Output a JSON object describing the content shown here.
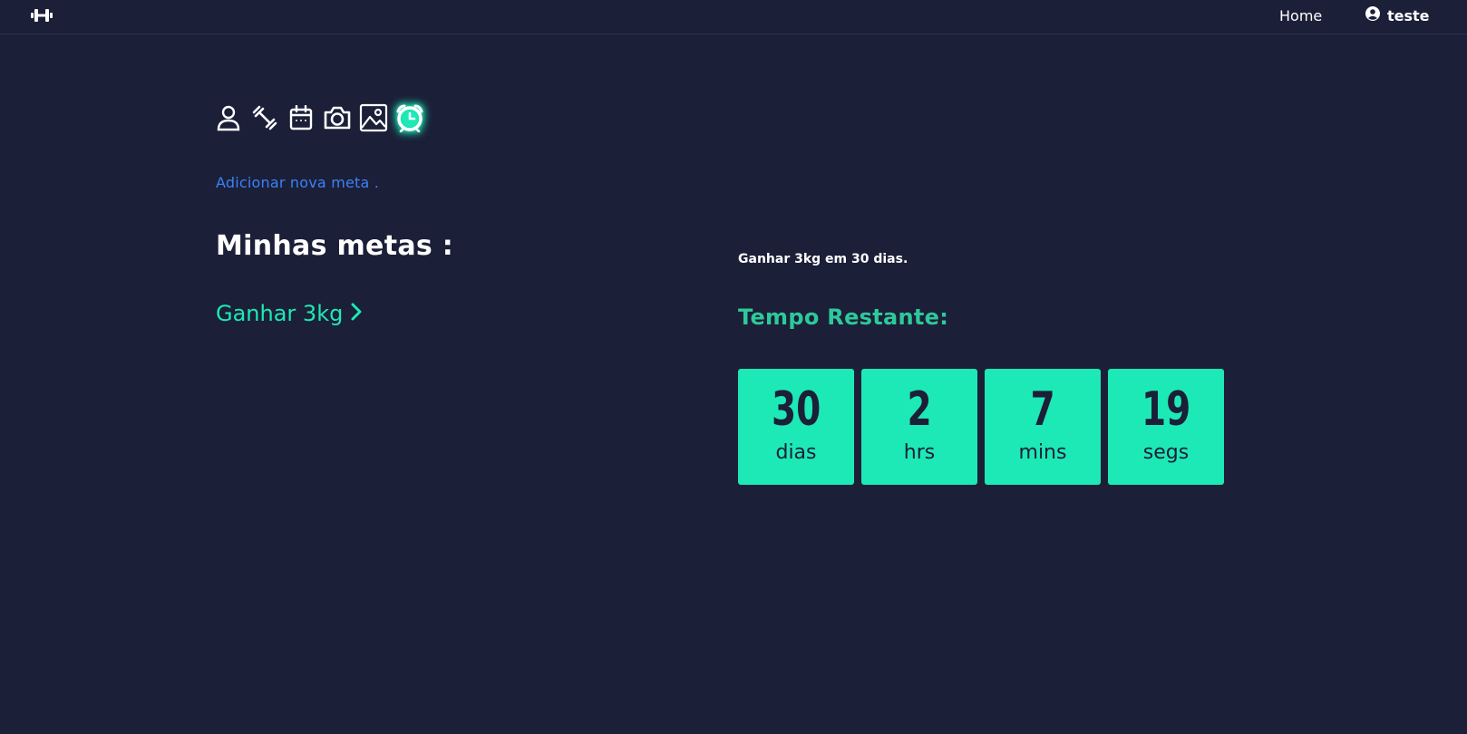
{
  "nav": {
    "home_label": "Home",
    "user_label": "teste"
  },
  "toolbar": {
    "icons": [
      "user-icon",
      "dumbbell-icon",
      "calendar-icon",
      "camera-icon",
      "image-icon",
      "alarm-clock-icon"
    ],
    "active_icon": "alarm-clock-icon"
  },
  "add_goal_label": "Adicionar nova meta .",
  "goals": {
    "title": "Minhas metas :",
    "items": [
      {
        "label": "Ganhar 3kg"
      }
    ]
  },
  "detail": {
    "description": "Ganhar 3kg em 30 dias.",
    "time_title": "Tempo Restante:",
    "countdown": [
      {
        "value": "30",
        "unit": "dias"
      },
      {
        "value": "2",
        "unit": "hrs"
      },
      {
        "value": "7",
        "unit": "mins"
      },
      {
        "value": "19",
        "unit": "segs"
      }
    ]
  },
  "colors": {
    "background": "#1b1f38",
    "accent": "#1de9b6",
    "link": "#3b82f6",
    "title_green": "#2ec99a"
  }
}
